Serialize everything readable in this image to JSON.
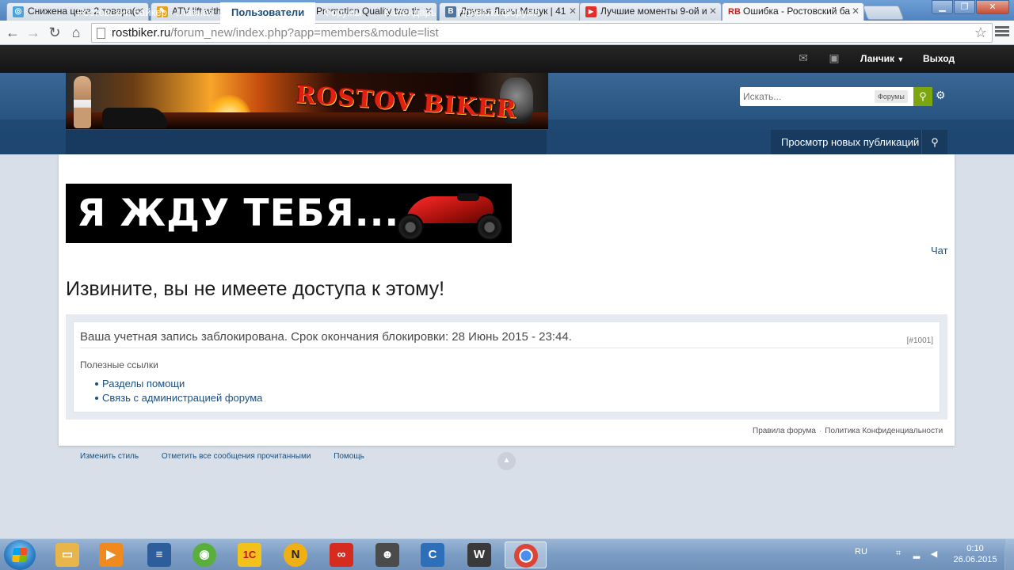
{
  "browser": {
    "tabs": [
      {
        "label": "Снижена цена 2 товара(с",
        "favicon_color": "#4aa3df",
        "favicon_char": "◎"
      },
      {
        "label": "ATV lift with side plate ma",
        "favicon_color": "#e9a216",
        "favicon_char": "✎"
      },
      {
        "label": "Promotion Quality two tir",
        "favicon_color": "#e9a216",
        "favicon_char": "✎"
      },
      {
        "label": "Друзья Ланы Мацук | 41",
        "favicon_color": "#4c75a3",
        "favicon_char": "В"
      },
      {
        "label": "Лучшие моменты 9-ой и",
        "favicon_color": "#e52d27",
        "favicon_char": "▶"
      },
      {
        "label": "Ошибка - Ростовский ба",
        "favicon_color": "#cc1f1a",
        "favicon_char": "RB"
      }
    ],
    "url_host": "rostbiker.ru",
    "url_path": "/forum_new/index.php?app=members&module=list"
  },
  "forum": {
    "user_name": "Ланчик",
    "logout_label": "Выход",
    "banner_text": "ROSTOV BIKER",
    "search_placeholder": "Искать...",
    "search_scope": "Форумы",
    "nav": [
      "Ростовский байкер - главная",
      "Пользователи",
      "Форумы",
      "Календарь",
      "Правила форума"
    ],
    "nav_active_index": 1,
    "nav_new_posts": "Просмотр новых публикаций",
    "promo_text": "Я ЖДУ ТЕБЯ...",
    "chat_link": "Чат",
    "error_title": "Извините, вы не имеете доступа к этому!",
    "error_message": "Ваша учетная запись заблокирована. Срок окончания блокировки: 28 Июнь 2015 - 23:44.",
    "error_code": "[#1001]",
    "useful_links_title": "Полезные ссылки",
    "useful_links": [
      "Разделы помощи",
      "Связь с администрацией форума"
    ],
    "footer_links": [
      "Правила форума",
      "Политика Конфиденциальности"
    ],
    "bottom_links": [
      "Изменить стиль",
      "Отметить все сообщения прочитанными",
      "Помощь"
    ]
  },
  "taskbar": {
    "apps": [
      {
        "name": "explorer",
        "color": "#e8b54a",
        "char": "▭"
      },
      {
        "name": "media-player",
        "color": "#f08a1f",
        "char": "▶"
      },
      {
        "name": "notepad",
        "color": "#2e5d9b",
        "char": "≡"
      },
      {
        "name": "globe-app",
        "color": "#5aae3b",
        "char": "◉"
      },
      {
        "name": "1c",
        "color": "#f2c21a",
        "char": "1С"
      },
      {
        "name": "nod-app",
        "color": "#f0b014",
        "char": "N"
      },
      {
        "name": "adobe-cc",
        "color": "#d62b1f",
        "char": "∞"
      },
      {
        "name": "game-portrait",
        "color": "#4b4b4b",
        "char": "☻"
      },
      {
        "name": "c-app",
        "color": "#2d6fb8",
        "char": "C"
      },
      {
        "name": "world-of-tanks",
        "color": "#3a3a3a",
        "char": "W"
      },
      {
        "name": "chrome",
        "color": "#db4437",
        "char": "◉"
      }
    ],
    "active_app_index": 10,
    "language": "RU",
    "time": "0:10",
    "date": "26.06.2015"
  }
}
